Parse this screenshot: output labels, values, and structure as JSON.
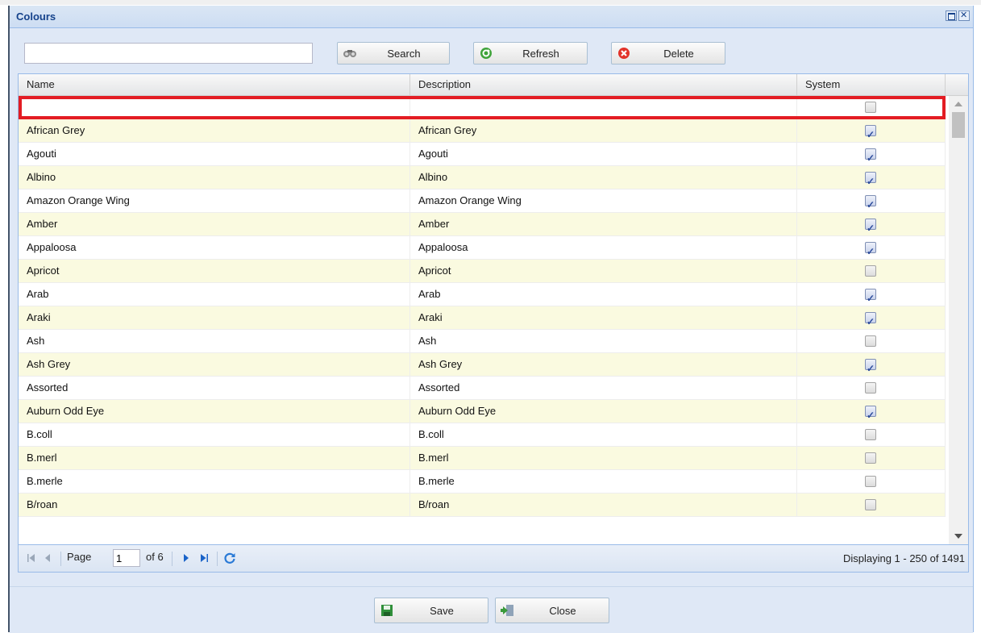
{
  "window": {
    "title": "Colours"
  },
  "toolbar": {
    "search_value": "",
    "search_label": "Search",
    "refresh_label": "Refresh",
    "delete_label": "Delete"
  },
  "grid": {
    "columns": [
      "Name",
      "Description",
      "System"
    ],
    "new_row": {
      "name": "",
      "description": "",
      "system": false
    },
    "rows": [
      {
        "name": "African Grey",
        "description": "African Grey",
        "system": true
      },
      {
        "name": "Agouti",
        "description": "Agouti",
        "system": true
      },
      {
        "name": "Albino",
        "description": "Albino",
        "system": true
      },
      {
        "name": "Amazon Orange Wing",
        "description": "Amazon Orange Wing",
        "system": true
      },
      {
        "name": "Amber",
        "description": "Amber",
        "system": true
      },
      {
        "name": "Appaloosa",
        "description": "Appaloosa",
        "system": true
      },
      {
        "name": "Apricot",
        "description": "Apricot",
        "system": false
      },
      {
        "name": "Arab",
        "description": "Arab",
        "system": true
      },
      {
        "name": "Araki",
        "description": "Araki",
        "system": true
      },
      {
        "name": "Ash",
        "description": "Ash",
        "system": false
      },
      {
        "name": "Ash Grey",
        "description": "Ash Grey",
        "system": true
      },
      {
        "name": "Assorted",
        "description": "Assorted",
        "system": false
      },
      {
        "name": "Auburn Odd Eye",
        "description": "Auburn Odd Eye",
        "system": true
      },
      {
        "name": "B.coll",
        "description": "B.coll",
        "system": false
      },
      {
        "name": "B.merl",
        "description": "B.merl",
        "system": false
      },
      {
        "name": "B.merle",
        "description": "B.merle",
        "system": false
      },
      {
        "name": "B/roan",
        "description": "B/roan",
        "system": false
      }
    ]
  },
  "pager": {
    "page_label": "Page",
    "page_value": "1",
    "of_label": "of 6",
    "display_text": "Displaying 1 - 250 of 1491"
  },
  "footer": {
    "save_label": "Save",
    "close_label": "Close"
  },
  "colors": {
    "highlight": "#e31c23",
    "alt_row": "#fafae0",
    "title": "#15428b"
  }
}
